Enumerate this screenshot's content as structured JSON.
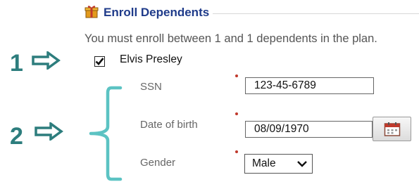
{
  "section": {
    "title": "Enroll Dependents",
    "icon": "gift-icon"
  },
  "instructions": "You must enroll between 1 and 1 dependents in the plan.",
  "annotations": {
    "step1": "1",
    "step2": "2",
    "arrow_icon": "right-arrow-icon",
    "brace_icon": "curly-brace-icon",
    "color": "#2d7d7d"
  },
  "dependent": {
    "name": "Elvis Presley",
    "checked": true
  },
  "fields": {
    "ssn": {
      "label": "SSN",
      "value": "123-45-6789"
    },
    "dob": {
      "label": "Date of birth",
      "value": "08/09/1970",
      "button_icon": "calendar-icon"
    },
    "gender": {
      "label": "Gender",
      "value": "Male",
      "dropdown_icon": "chevron-down-icon"
    }
  },
  "colors": {
    "title": "#1f3b8a",
    "required_marker": "#c0392b"
  }
}
